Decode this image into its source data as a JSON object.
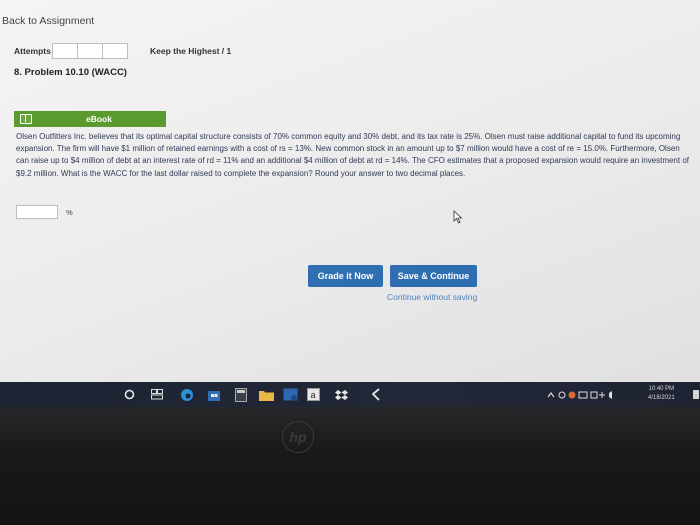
{
  "header": {
    "back_link": "Back to Assignment",
    "attempts_label": "Attempts",
    "keep_label": "Keep the Highest / 1"
  },
  "problem": {
    "title": "8. Problem 10.10 (WACC)",
    "ebook_label": "eBook",
    "text": "Olsen Outfitters Inc. believes that its optimal capital structure consists of 70% common equity and 30% debt, and its tax rate is 25%. Olsen must raise additional capital to fund its upcoming expansion. The firm will have $1 million of retained earnings with a cost of rs = 13%. New common stock in an amount up to $7 million would have a cost of re = 15.0%. Furthermore, Olsen can raise up to $4 million of debt at an interest rate of rd = 11% and an additional $4 million of debt at rd = 14%. The CFO estimates that a proposed expansion would require an investment of $9.2 million. What is the WACC for the last dollar raised to complete the expansion? Round your answer to two decimal places.",
    "answer_value": "",
    "answer_unit": "%"
  },
  "buttons": {
    "grade": "Grade it Now",
    "save": "Save & Continue",
    "continue": "Continue without saving"
  },
  "taskbar": {
    "time": "10:40 PM",
    "date": "4/18/2021",
    "icons": [
      "search-icon",
      "task-view-icon",
      "edge-icon",
      "store-icon",
      "calculator-icon",
      "file-explorer-icon",
      "amazon-icon",
      "dropbox-icon",
      "vscode-icon"
    ]
  },
  "bezel": {
    "logo": "hp"
  }
}
